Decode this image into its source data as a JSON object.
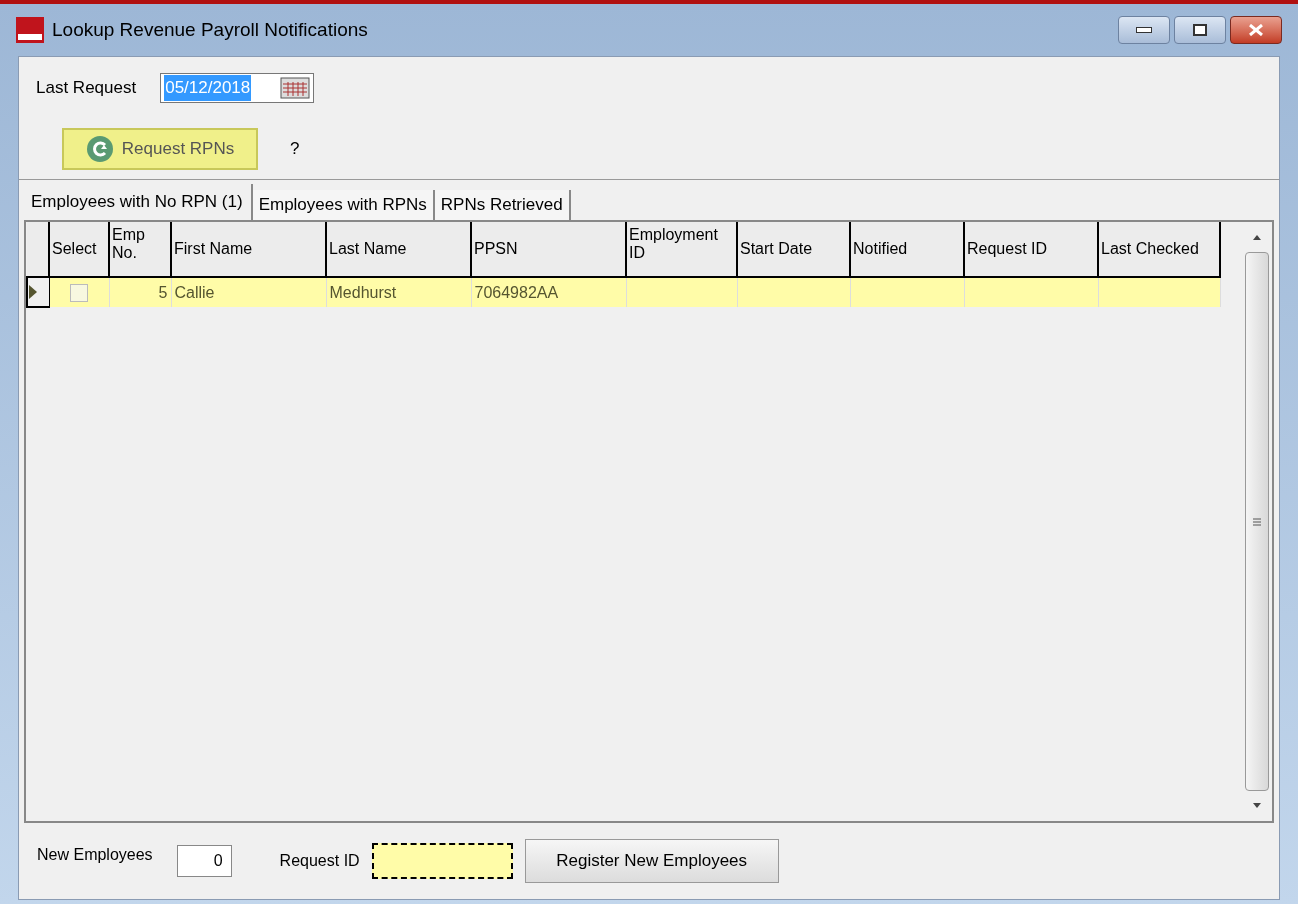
{
  "window": {
    "title": "Lookup Revenue Payroll Notifications"
  },
  "last_request": {
    "label": "Last Request",
    "value": "05/12/2018"
  },
  "request_button": {
    "label": "Request RPNs"
  },
  "help": "?",
  "tabs": [
    {
      "label": "Employees with No RPN (1)",
      "selected": true
    },
    {
      "label": "Employees with RPNs",
      "selected": false
    },
    {
      "label": "RPNs Retrieved",
      "selected": false
    }
  ],
  "table": {
    "columns": [
      "Select",
      "Emp No.",
      "First Name",
      "Last Name",
      "PPSN",
      "Employment ID",
      "Start Date",
      "Notified",
      "Request ID",
      "Last Checked"
    ],
    "rows": [
      {
        "selected": true,
        "checked": false,
        "cells": [
          "",
          "5",
          "Callie",
          "Medhurst",
          "7064982AA",
          "",
          "",
          "",
          "",
          ""
        ]
      }
    ]
  },
  "footer": {
    "new_employees_label": "New Employees",
    "new_employees_value": "0",
    "request_id_label": "Request ID",
    "register_button": "Register New Employees"
  }
}
